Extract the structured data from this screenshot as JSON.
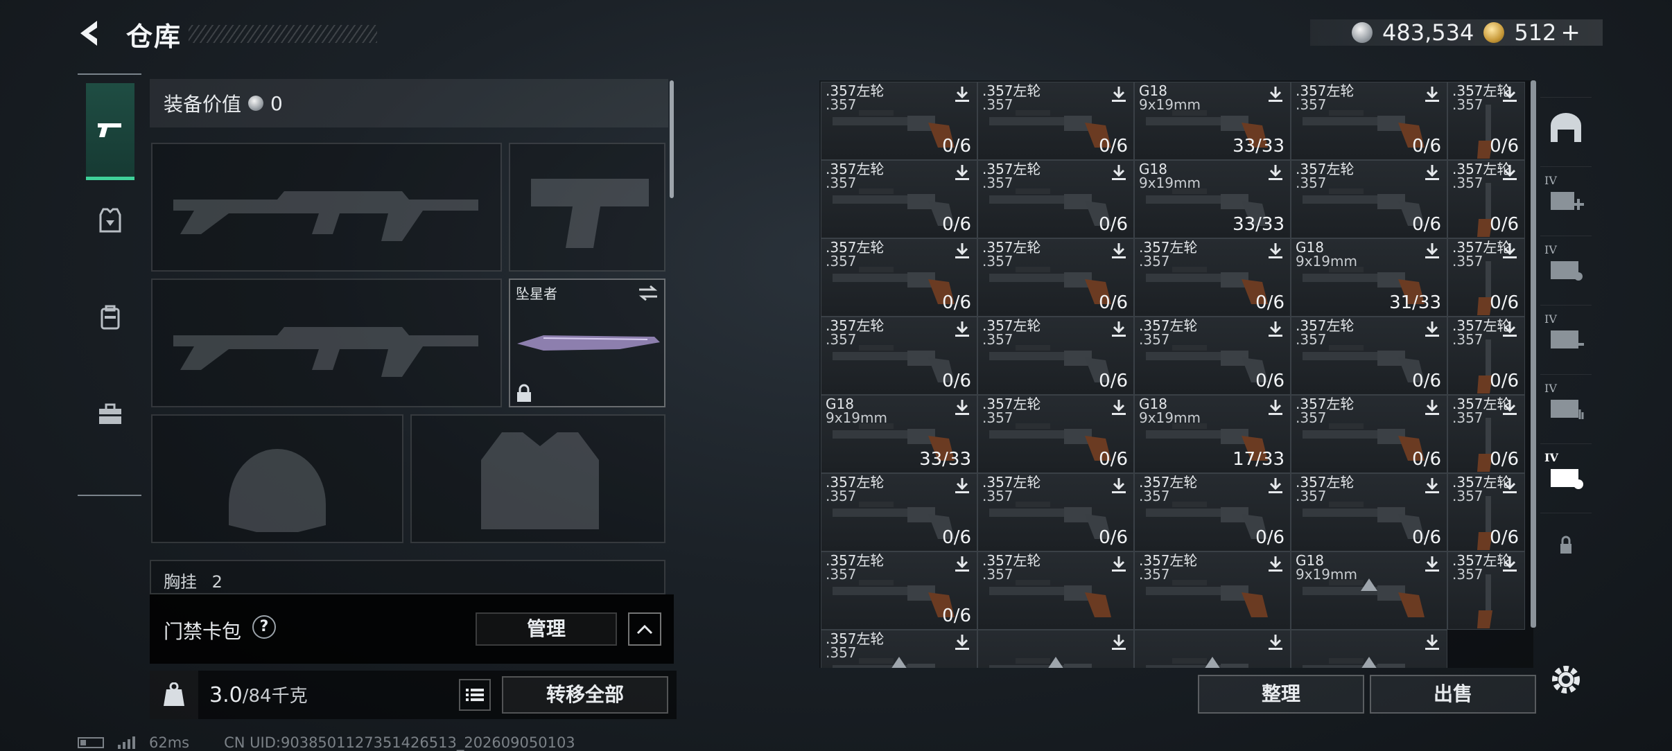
{
  "header": {
    "title": "仓库"
  },
  "currency": {
    "silver": "483,534",
    "gold": "512",
    "plus": "+"
  },
  "loadout": {
    "equip_value_label": "装备价值",
    "equip_value": "0",
    "melee_name": "坠星者",
    "chest_label": "胸挂",
    "chest_value": "2"
  },
  "access_card": {
    "label": "门禁卡包",
    "help": "?",
    "manage": "管理"
  },
  "weight": {
    "current": "3.0",
    "capacity": "/84千克"
  },
  "buttons": {
    "transfer_all": "转移全部",
    "sort": "整理",
    "sell": "出售"
  },
  "status": {
    "ping": "62ms",
    "uid": "CN UID:9038501127351426513_202609050103"
  },
  "storage": {
    "items": [
      {
        "name": ".357左轮",
        "cal": ".357",
        "count": "0/6"
      },
      {
        "name": ".357左轮",
        "cal": ".357",
        "count": "0/6"
      },
      {
        "name": "G18",
        "cal": "9x19mm",
        "count": "33/33"
      },
      {
        "name": ".357左轮",
        "cal": ".357",
        "count": "0/6"
      },
      {
        "name": ".357左轮",
        "cal": ".357",
        "count": "0/6"
      },
      {
        "name": ".357左轮",
        "cal": ".357",
        "count": "0/6"
      },
      {
        "name": ".357左轮",
        "cal": ".357",
        "count": "0/6"
      },
      {
        "name": "G18",
        "cal": "9x19mm",
        "count": "33/33"
      },
      {
        "name": ".357左轮",
        "cal": ".357",
        "count": "0/6"
      },
      {
        "name": ".357左轮",
        "cal": ".357",
        "count": "0/6"
      },
      {
        "name": ".357左轮",
        "cal": ".357",
        "count": "0/6"
      },
      {
        "name": ".357左轮",
        "cal": ".357",
        "count": "0/6"
      },
      {
        "name": ".357左轮",
        "cal": ".357",
        "count": "0/6"
      },
      {
        "name": "G18",
        "cal": "9x19mm",
        "count": "31/33"
      },
      {
        "name": ".357左轮",
        "cal": ".357",
        "count": "0/6"
      },
      {
        "name": ".357左轮",
        "cal": ".357",
        "count": "0/6"
      },
      {
        "name": ".357左轮",
        "cal": ".357",
        "count": "0/6"
      },
      {
        "name": ".357左轮",
        "cal": ".357",
        "count": "0/6"
      },
      {
        "name": ".357左轮",
        "cal": ".357",
        "count": "0/6"
      },
      {
        "name": ".357左轮",
        "cal": ".357",
        "count": "0/6"
      },
      {
        "name": "G18",
        "cal": "9x19mm",
        "count": "33/33"
      },
      {
        "name": ".357左轮",
        "cal": ".357",
        "count": "0/6"
      },
      {
        "name": "G18",
        "cal": "9x19mm",
        "count": "17/33"
      },
      {
        "name": ".357左轮",
        "cal": ".357",
        "count": "0/6"
      },
      {
        "name": ".357左轮",
        "cal": ".357",
        "count": "0/6"
      },
      {
        "name": ".357左轮",
        "cal": ".357",
        "count": "0/6"
      },
      {
        "name": ".357左轮",
        "cal": ".357",
        "count": "0/6"
      },
      {
        "name": ".357左轮",
        "cal": ".357",
        "count": "0/6"
      },
      {
        "name": ".357左轮",
        "cal": ".357",
        "count": "0/6"
      },
      {
        "name": ".357左轮",
        "cal": ".357",
        "count": "0/6"
      },
      {
        "name": ".357左轮",
        "cal": ".357",
        "count": "0/6"
      },
      {
        "name": ".357左轮",
        "cal": ".357",
        "count": ""
      },
      {
        "name": ".357左轮",
        "cal": ".357",
        "count": ""
      },
      {
        "name": "G18",
        "cal": "9x19mm",
        "count": ""
      },
      {
        "name": ".357左轮",
        "cal": ".357",
        "count": ""
      },
      {
        "name": ".357左轮",
        "cal": ".357",
        "count": ""
      }
    ]
  },
  "rail": {
    "tier": "IV"
  }
}
